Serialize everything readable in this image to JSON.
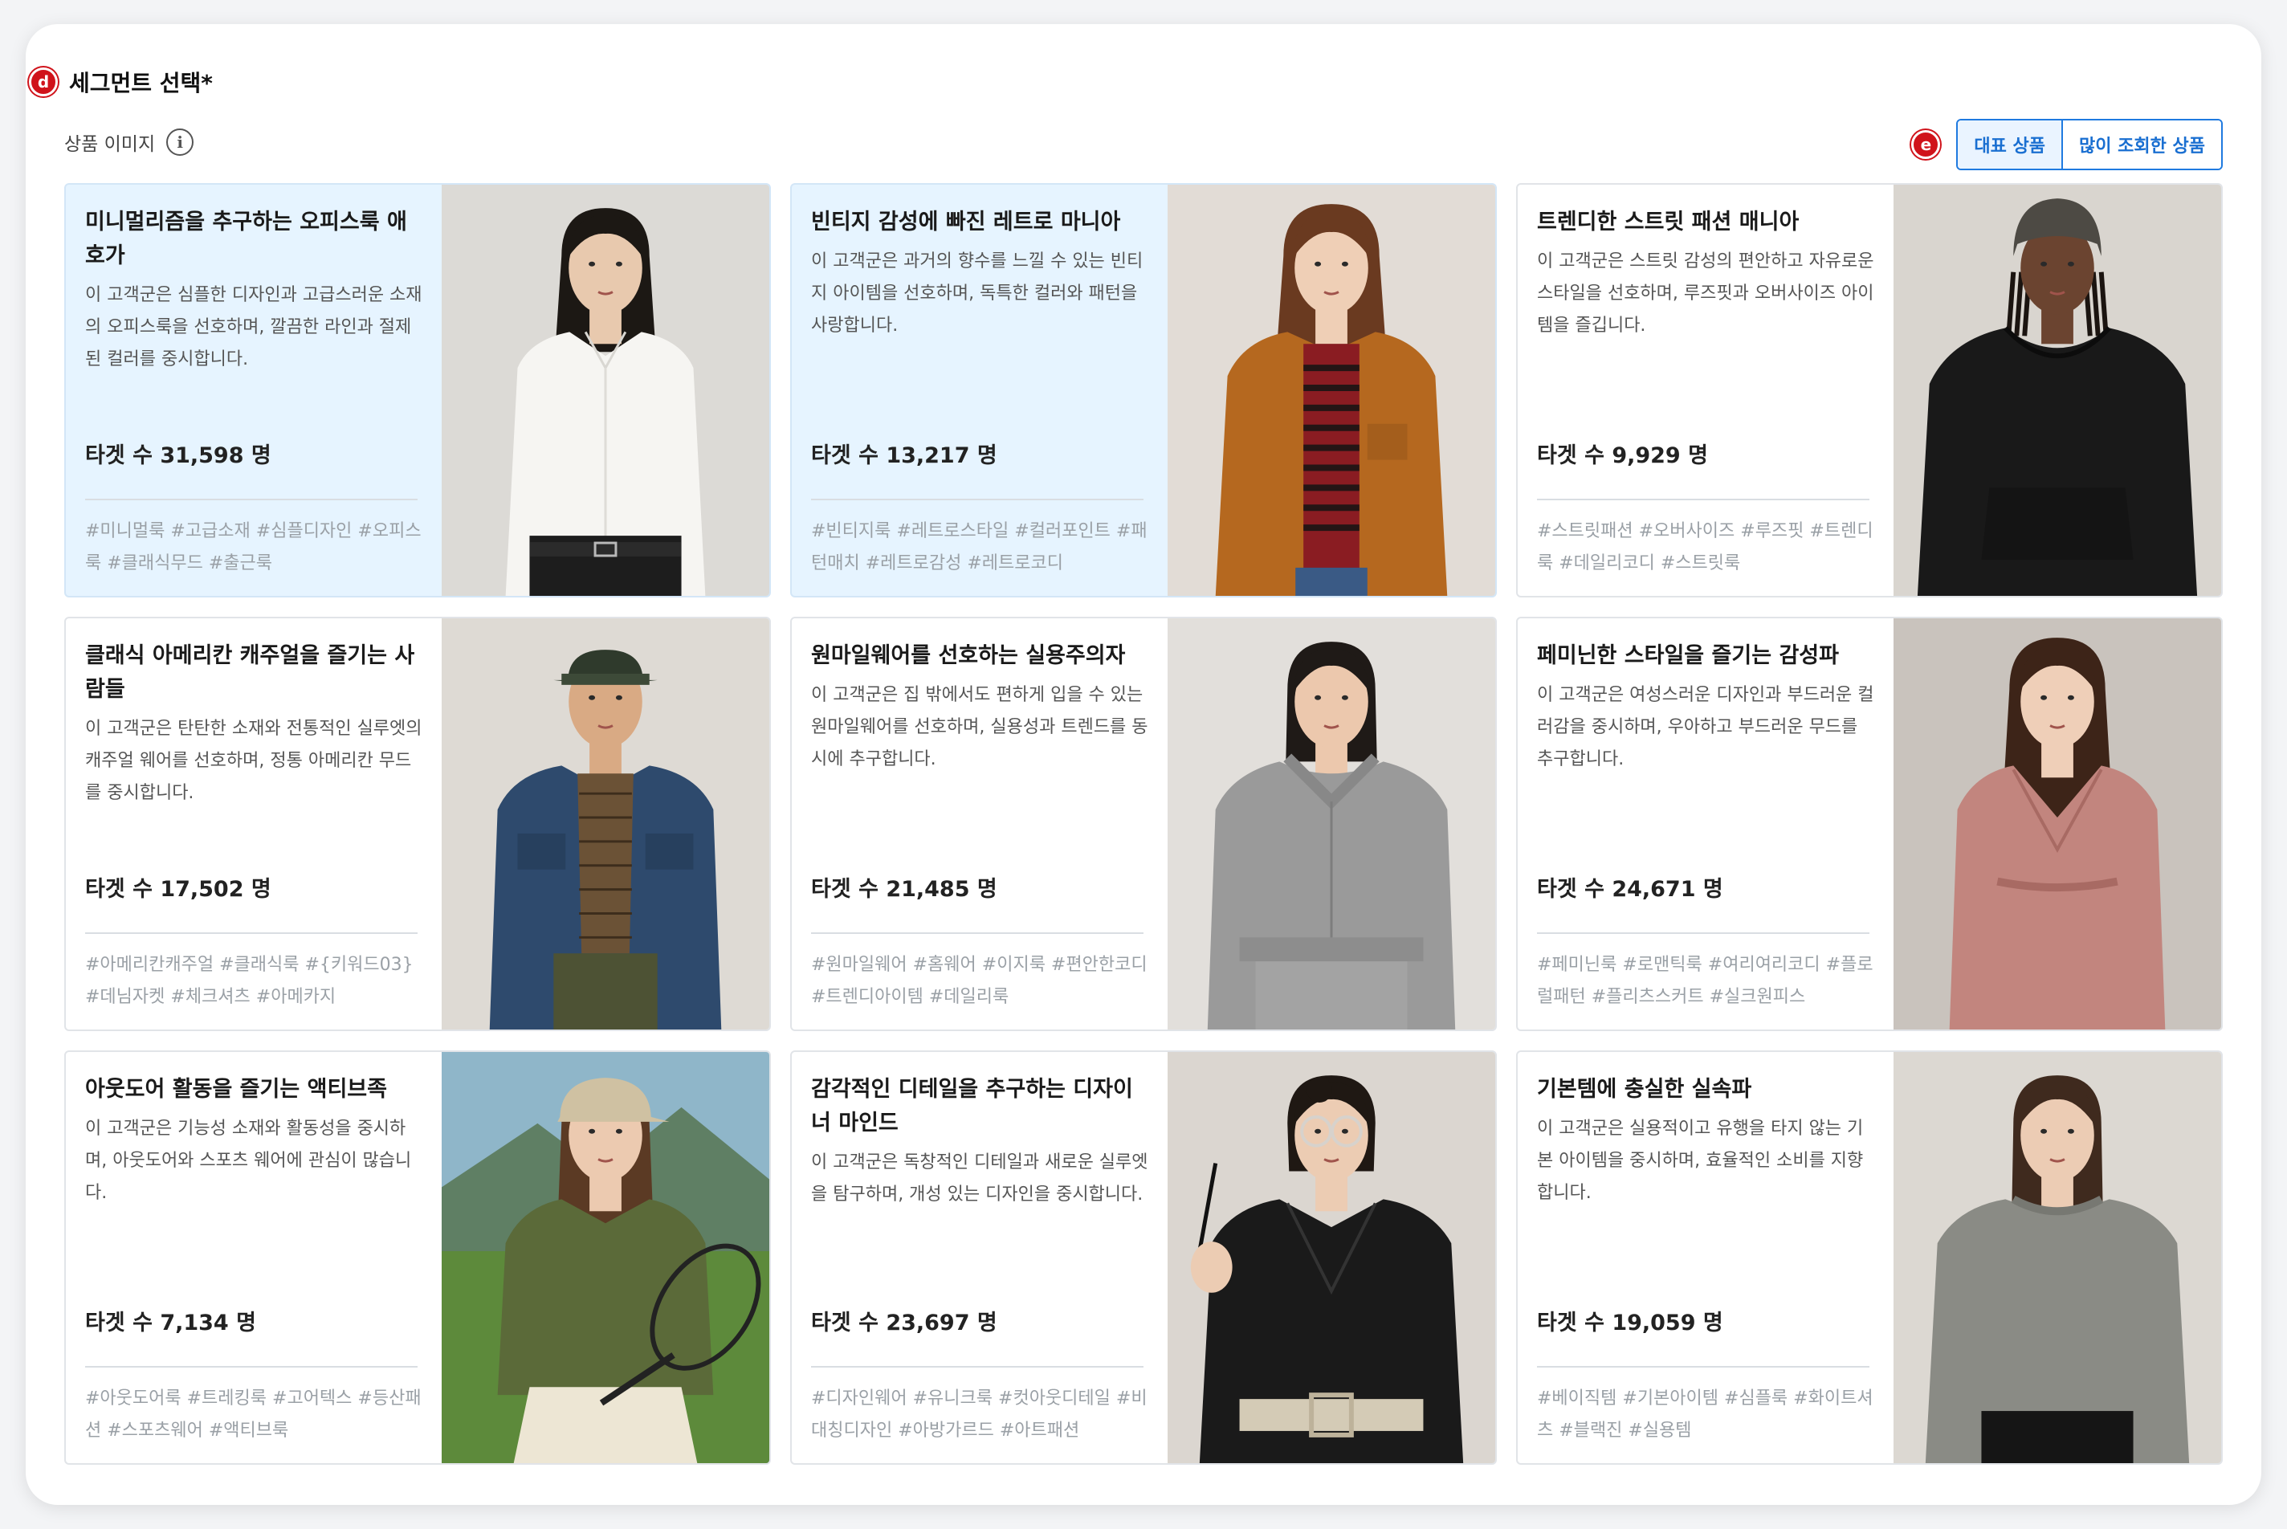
{
  "header": {
    "badge_d": "d",
    "title": "세그먼트 선택*",
    "sub_label": "상품 이미지",
    "info_icon": "info-icon",
    "badge_e": "e",
    "toggle": {
      "representative": "대표 상품",
      "most_viewed": "많이 조회한 상품",
      "selected": "representative"
    }
  },
  "colors": {
    "accent": "#1f7ae0",
    "selected_bg": "#e6f4ff",
    "badge": "#d0131b"
  },
  "segments": [
    {
      "title": "미니멀리즘을 추구하는 오피스룩 애호가",
      "desc": "이 고객군은 심플한 디자인과 고급스러운 소재의 오피스룩을 선호하며, 깔끔한 라인과 절제된 컬러를 중시합니다.",
      "target": "타겟 수 31,598 명",
      "tags": "#미니멀룩 #고급소재 #심플디자인 #오피스룩 #클래식무드 #출근룩",
      "selected": true,
      "image": "woman-white-shirt"
    },
    {
      "title": "빈티지 감성에 빠진 레트로 마니아",
      "desc": "이 고객군은 과거의 향수를 느낄 수 있는 빈티지 아이템을 선호하며, 독특한 컬러와 패턴을 사랑합니다.",
      "target": "타겟 수 13,217 명",
      "tags": "#빈티지룩 #레트로스타일 #컬러포인트 #패턴매치 #레트로감성 #레트로코디",
      "selected": true,
      "image": "woman-corduroy-jacket"
    },
    {
      "title": "트렌디한 스트릿 패션 매니아",
      "desc": "이 고객군은 스트릿 감성의 편안하고 자유로운 스타일을 선호하며, 루즈핏과 오버사이즈 아이템을 즐깁니다.",
      "target": "타겟 수 9,929 명",
      "tags": "#스트릿패션 #오버사이즈 #루즈핏 #트렌디룩 #데일리코디 #스트릿룩",
      "selected": false,
      "image": "man-black-hoodie"
    },
    {
      "title": "클래식 아메리칸 캐주얼을 즐기는 사람들",
      "desc": "이 고객군은 탄탄한 소재와 전통적인 실루엣의 캐주얼 웨어를 선호하며, 정통 아메리칸 무드를 중시합니다.",
      "target": "타겟 수 17,502 명",
      "tags": "#아메리칸캐주얼 #클래식룩 #{키워드03} #데님자켓 #체크셔츠 #아메카지",
      "selected": false,
      "image": "man-denim-jacket"
    },
    {
      "title": "원마일웨어를 선호하는 실용주의자",
      "desc": "이 고객군은 집 밖에서도 편하게 입을 수 있는 원마일웨어를 선호하며, 실용성과 트렌드를 동시에 추구합니다.",
      "target": "타겟 수 21,485 명",
      "tags": "#원마일웨어 #홈웨어 #이지룩 #편안한코디 #트렌디아이템 #데일리룩",
      "selected": false,
      "image": "woman-grey-sweatsuit"
    },
    {
      "title": "페미닌한 스타일을 즐기는 감성파",
      "desc": "이 고객군은 여성스러운 디자인과 부드러운 컬러감을 중시하며, 우아하고 부드러운 무드를 추구합니다.",
      "target": "타겟 수 24,671 명",
      "tags": "#페미닌룩 #로맨틱룩 #여리여리코디 #플로럴패턴 #플리츠스커트 #실크원피스",
      "selected": false,
      "image": "woman-pink-dress"
    },
    {
      "title": "아웃도어 활동을 즐기는 액티브족",
      "desc": "이 고객군은 기능성 소재와 활동성을 중시하며, 아웃도어와 스포츠 웨어에 관심이 많습니다.",
      "target": "타겟 수 7,134 명",
      "tags": "#아웃도어룩 #트레킹룩 #고어텍스 #등산패션 #스포츠웨어 #액티브룩",
      "selected": false,
      "image": "woman-outdoor-tennis"
    },
    {
      "title": "감각적인 디테일을 추구하는 디자이너 마인드",
      "desc": "이 고객군은 독창적인 디테일과 새로운 실루엣을 탐구하며, 개성 있는 디자인을 중시합니다.",
      "target": "타겟 수 23,697 명",
      "tags": "#디자인웨어 #유니크룩 #컷아웃디테일 #비대칭디자인 #아방가르드 #아트패션",
      "selected": false,
      "image": "woman-black-jacket-glasses"
    },
    {
      "title": "기본템에 충실한 실속파",
      "desc": "이 고객군은 실용적이고 유행을 타지 않는 기본 아이템을 중시하며, 효율적인 소비를 지향합니다.",
      "target": "타겟 수 19,059 명",
      "tags": "#베이직템 #기본아이템 #심플룩 #화이트셔츠 #블랙진 #실용템",
      "selected": false,
      "image": "woman-grey-sweatshirt"
    }
  ]
}
